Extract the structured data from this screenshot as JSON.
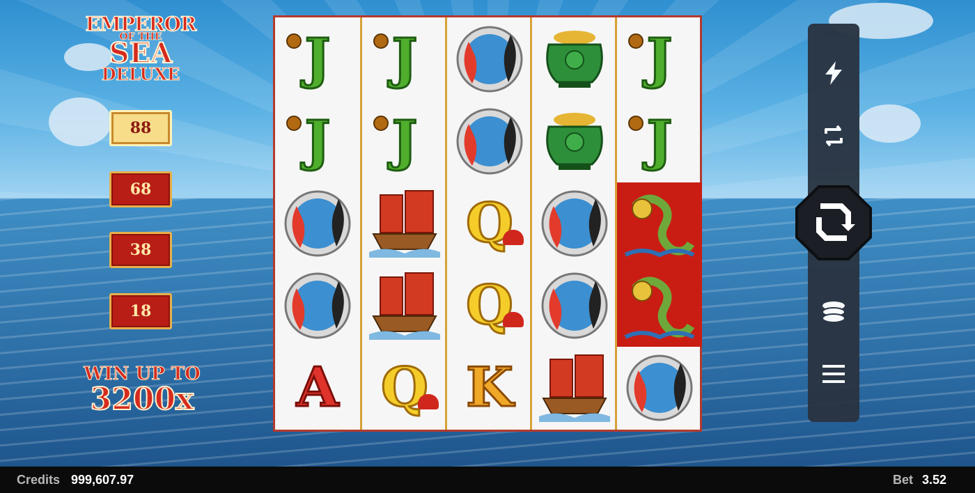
{
  "logo": {
    "line1": "EMPEROR",
    "line2": "OF THE",
    "line3": "SEA",
    "line4": "DELUXE"
  },
  "ways_selector": {
    "options": [
      {
        "label": "88",
        "selected": true
      },
      {
        "label": "68",
        "selected": false
      },
      {
        "label": "38",
        "selected": false
      },
      {
        "label": "18",
        "selected": false
      }
    ]
  },
  "promo": {
    "label": "WIN UP TO",
    "value": "3200x"
  },
  "reels": [
    [
      "J",
      "J",
      "koi",
      "koi",
      "A"
    ],
    [
      "J",
      "J",
      "junk",
      "junk",
      "Q"
    ],
    [
      "koi",
      "koi",
      "Q",
      "Q",
      "K"
    ],
    [
      "pot",
      "pot",
      "koi",
      "koi",
      "junk"
    ],
    [
      "J",
      "J",
      "dragon",
      "dragon",
      "koi"
    ]
  ],
  "controls": {
    "turbo_icon": "lightning-icon",
    "autoplay_icon": "autoplay-icon",
    "spin_icon": "spin-icon",
    "bet_icon": "coins-stack-icon",
    "menu_icon": "menu-icon"
  },
  "status": {
    "credits_label": "Credits",
    "credits_value": "999,607.97",
    "bet_label": "Bet",
    "bet_value": "3.52"
  },
  "colors": {
    "accent_red": "#b81e16",
    "gold": "#e7b04a",
    "panel": "#2a3442"
  }
}
